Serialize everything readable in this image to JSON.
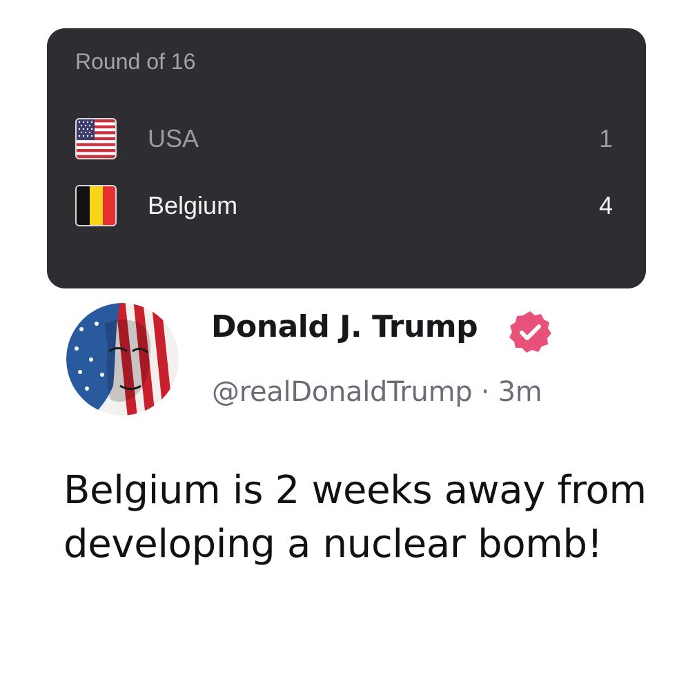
{
  "scoreboard": {
    "round_label": "Round of 16",
    "teams": [
      {
        "name": "USA",
        "score": "1",
        "flag_icon": "usa-flag-icon"
      },
      {
        "name": "Belgium",
        "score": "4",
        "flag_icon": "belgium-flag-icon"
      }
    ],
    "colors": {
      "card_bg": "#2e2e32",
      "loser_text": "#9b9ba2",
      "winner_text": "#f4f4f6"
    }
  },
  "tweet": {
    "display_name": "Donald J. Trump",
    "verified_icon": "verified-badge-icon",
    "handle": "@realDonaldTrump",
    "separator": "·",
    "time_ago": "3m",
    "text": "Belgium is 2 weeks away from developing a nuclear bomb!",
    "colors": {
      "badge": "#e8517a"
    }
  }
}
